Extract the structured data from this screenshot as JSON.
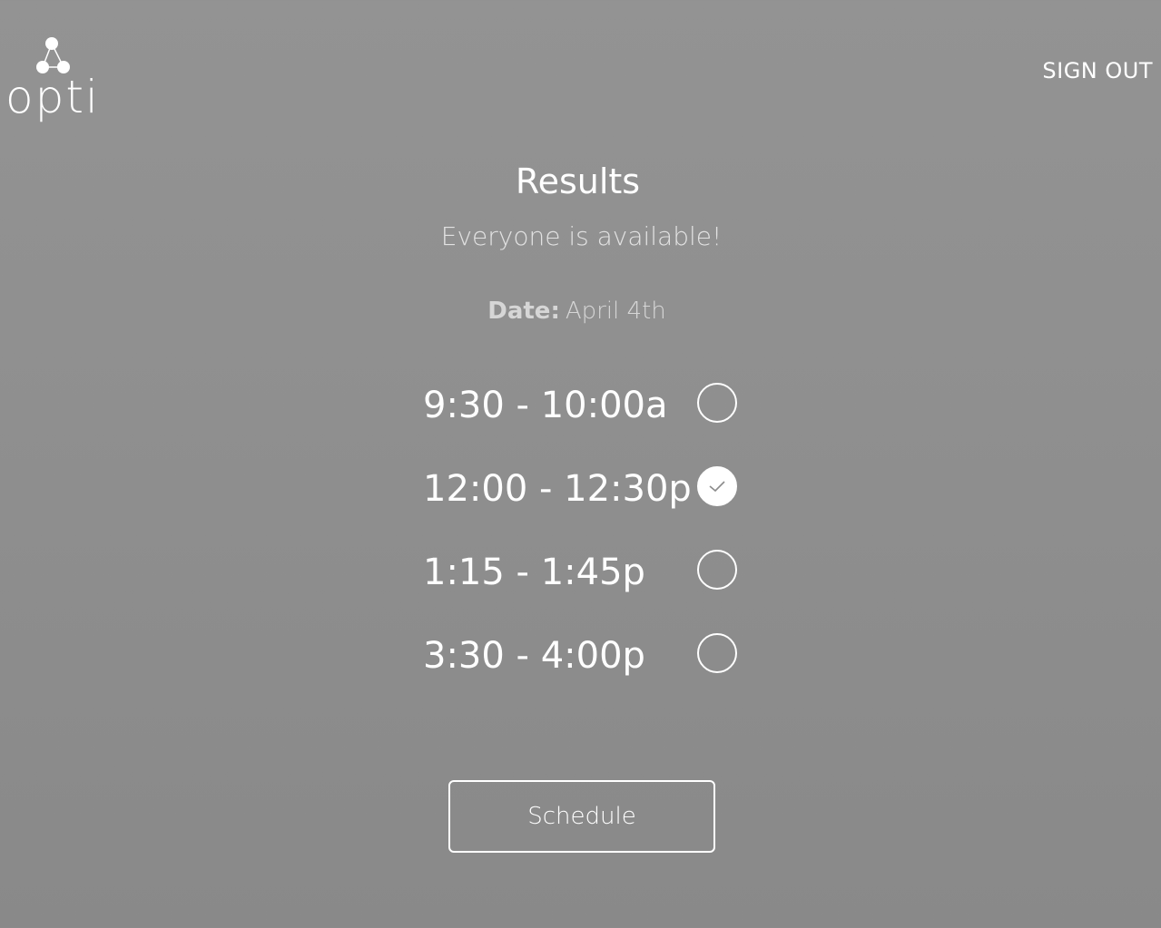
{
  "header": {
    "logo_text": "opti",
    "sign_out_label": "SIGN OUT"
  },
  "results": {
    "title": "Results",
    "subtitle": "Everyone is available!",
    "date_label": "Date:",
    "date_value": "April 4th"
  },
  "slots": [
    {
      "time": "9:30 - 10:00a",
      "selected": false
    },
    {
      "time": "12:00 - 12:30p",
      "selected": true
    },
    {
      "time": "1:15 - 1:45p",
      "selected": false
    },
    {
      "time": "3:30 - 4:00p",
      "selected": false
    }
  ],
  "actions": {
    "schedule_label": "Schedule"
  },
  "colors": {
    "background": "#909090",
    "foreground": "#ffffff",
    "check": "#8c8c8c"
  }
}
